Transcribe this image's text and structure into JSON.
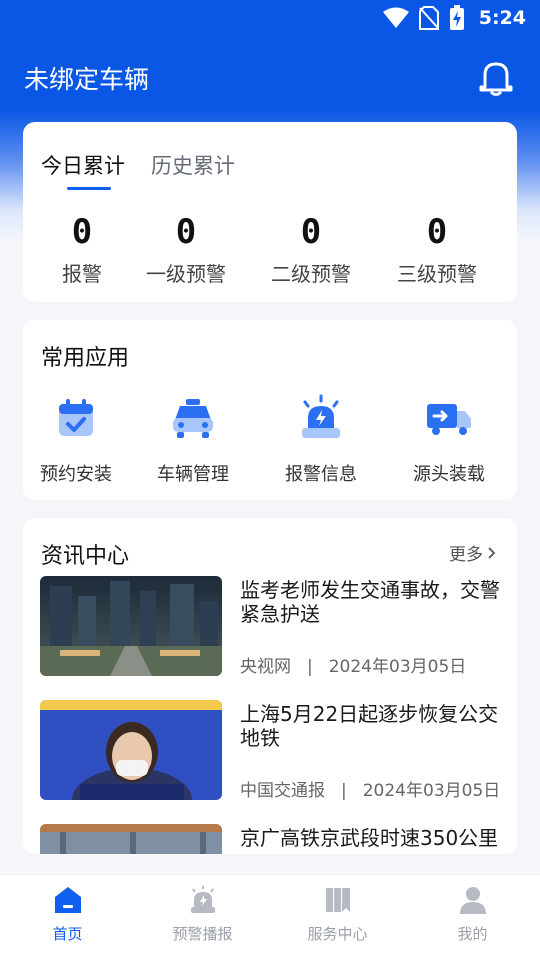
{
  "status_bar": {
    "time": "5:24"
  },
  "header": {
    "title": "未绑定车辆"
  },
  "stats": {
    "tabs": [
      "今日累计",
      "历史累计"
    ],
    "items": [
      {
        "value": "0",
        "label": "报警"
      },
      {
        "value": "0",
        "label": "一级预警"
      },
      {
        "value": "0",
        "label": "二级预警"
      },
      {
        "value": "0",
        "label": "三级预警"
      }
    ]
  },
  "apps": {
    "title": "常用应用",
    "items": [
      {
        "label": "预约安装",
        "icon": "calendar-check-icon"
      },
      {
        "label": "车辆管理",
        "icon": "taxi-icon"
      },
      {
        "label": "报警信息",
        "icon": "alarm-light-icon"
      },
      {
        "label": "源头装载",
        "icon": "truck-icon"
      }
    ]
  },
  "news": {
    "title": "资讯中心",
    "more": "更多",
    "items": [
      {
        "title": "监考老师发生交通事故，交警紧急护送",
        "source": "央视网",
        "separator": "|",
        "date": "2024年03月05日"
      },
      {
        "title": "上海5月22日起逐步恢复公交地铁",
        "source": "中国交通报",
        "separator": "|",
        "date": "2024年03月05日"
      },
      {
        "title": "京广高铁京武段时速350公里",
        "source": "",
        "separator": "",
        "date": ""
      }
    ]
  },
  "bottom_nav": {
    "items": [
      {
        "label": "首页",
        "icon": "home-icon"
      },
      {
        "label": "预警播报",
        "icon": "alarm-icon"
      },
      {
        "label": "服务中心",
        "icon": "service-icon"
      },
      {
        "label": "我的",
        "icon": "user-icon"
      }
    ]
  },
  "colors": {
    "primary": "#0a57e6",
    "accent": "#1060f0",
    "inactive": "#9aa0aa"
  }
}
